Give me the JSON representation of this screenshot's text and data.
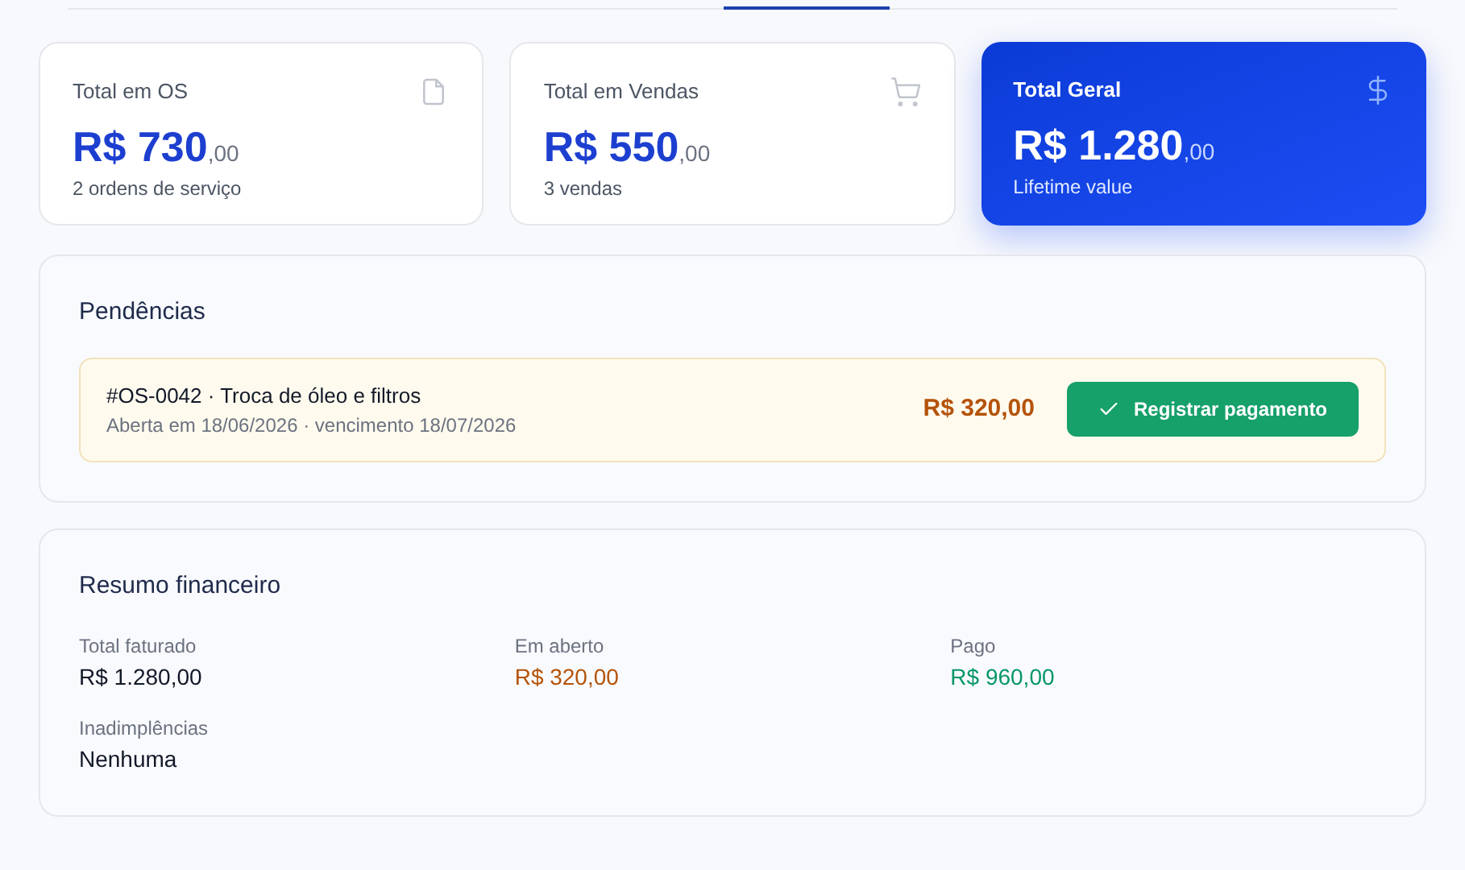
{
  "stat_cards": [
    {
      "kind": "plain",
      "title": "Total em OS",
      "amount": "R$ 730",
      "cents": ",00",
      "caption": "2 ordens de serviço"
    },
    {
      "kind": "plain",
      "title": "Total em Vendas",
      "amount": "R$ 550",
      "cents": ",00",
      "caption": "3 vendas"
    },
    {
      "kind": "highlight",
      "title": "Total Geral",
      "amount": "R$ 1.280",
      "cents": ",00",
      "caption": "Lifetime value"
    }
  ],
  "pending": {
    "title": "Pendências",
    "items": [
      {
        "title": "#OS-0042 · Troca de óleo e filtros",
        "subtitle": "Aberta em 18/06/2026 · vencimento 18/07/2026",
        "amount": "R$ 320,00",
        "action": "Registrar pagamento"
      }
    ]
  },
  "summary": {
    "title": "Resumo financeiro",
    "items": [
      {
        "label": "Total faturado",
        "value": "R$ 1.280,00",
        "color": "#111827"
      },
      {
        "label": "Em aberto",
        "value": "R$ 320,00",
        "color": "#b45309"
      },
      {
        "label": "Pago",
        "value": "R$ 960,00",
        "color": "#059669"
      },
      {
        "label": "Inadimplências",
        "value": "Nenhuma",
        "color": "#111827"
      }
    ]
  }
}
